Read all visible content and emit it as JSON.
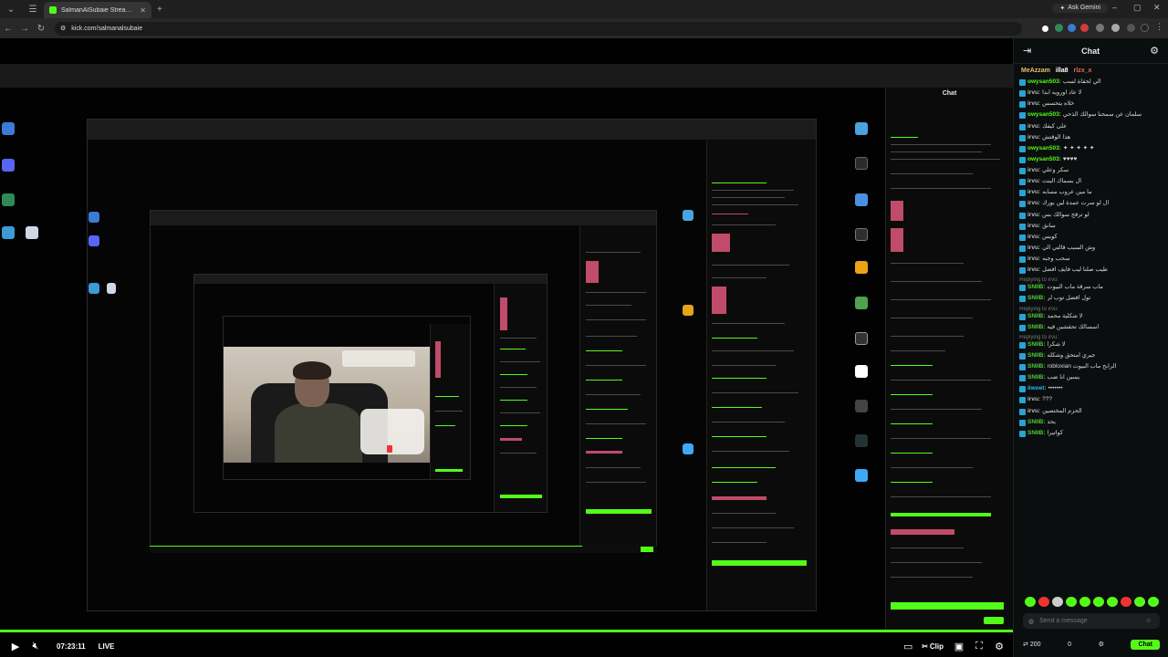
{
  "browser": {
    "tabs": [
      {
        "title": "SalmanAlSubaie Stream - Wa",
        "active": true
      }
    ],
    "ask_gemini": "Ask Gemini",
    "url": "kick.com/salmanalsubaie"
  },
  "nested_chat_title": "Chat",
  "player": {
    "time": "07:23:11",
    "live": "LIVE",
    "clip": "Clip"
  },
  "chat": {
    "title": "Chat",
    "pinned": [
      "MeAzzam",
      "illa8",
      "rlzx_x"
    ],
    "messages": [
      {
        "user": "owysan503:",
        "text": "الي لحقاة لسب",
        "cls": "u-owysan"
      },
      {
        "user": "irvu:",
        "text": "لا عاد اورويه ابداً",
        "cls": "u-irvu"
      },
      {
        "user": "irvu:",
        "text": "خلاه يتحسس",
        "cls": "u-irvu"
      },
      {
        "user": "owysan503:",
        "text": "سلمان عن سمحنا سوالك الذحي",
        "cls": "u-owysan"
      },
      {
        "user": "irvu:",
        "text": "على كيفك",
        "cls": "u-irvu"
      },
      {
        "user": "irvu:",
        "text": "هذا الوقتش",
        "cls": "u-irvu"
      },
      {
        "user": "owysan503:",
        "text": "✦ ✦ ✦ ✦ ✦",
        "cls": "u-owysan"
      },
      {
        "user": "owysan503:",
        "text": "♥♥♥♥",
        "cls": "u-owysan"
      },
      {
        "user": "irvu:",
        "text": "سكر وعلي",
        "cls": "u-irvu"
      },
      {
        "user": "irvu:",
        "text": "ال بسماك البنت",
        "cls": "u-irvu"
      },
      {
        "user": "irvu:",
        "text": "ما مين عروب مسابه",
        "cls": "u-irvu"
      },
      {
        "user": "irvu:",
        "text": "ال لو سرت عمدة لين بورك",
        "cls": "u-irvu"
      },
      {
        "user": "irvu:",
        "text": "لو ترقح سوالك بس",
        "cls": "u-irvu"
      },
      {
        "user": "irvu:",
        "text": "سانق",
        "cls": "u-irvu"
      },
      {
        "user": "irvu:",
        "text": "كويس",
        "cls": "u-irvu"
      },
      {
        "user": "irvu:",
        "text": "وش السبب قالتي الي",
        "cls": "u-irvu"
      },
      {
        "user": "irvu:",
        "text": "سحب وجبه",
        "cls": "u-irvu"
      },
      {
        "user": "irvu:",
        "text": "طيب صلنا ليب فايف افضل",
        "cls": "u-irvu"
      },
      {
        "user": "SNIIB:",
        "text": "ماب سرقة ماب البيوت",
        "cls": "u-snib",
        "reply": "Replying to irvu:"
      },
      {
        "user": "SNIIB:",
        "text": "تول افضل توب لر",
        "cls": "u-snib"
      },
      {
        "user": "SNIIB:",
        "text": "لا شكلية محمد",
        "cls": "u-snib",
        "reply": "Replying to irvu:"
      },
      {
        "user": "SNIIB:",
        "text": "اسسالك تحقشين قيه",
        "cls": "u-snib"
      },
      {
        "user": "SNIIB:",
        "text": "لا شكرا",
        "cls": "u-snib",
        "reply": "Replying to irvu:"
      },
      {
        "user": "SNIIB:",
        "text": "جيري امتحق وشكله",
        "cls": "u-snib"
      },
      {
        "user": "SNIIB:",
        "text": "robloxian الرابح ماب البيوت",
        "cls": "u-snib"
      },
      {
        "user": "SNIIB:",
        "text": "يسين انا ضب",
        "cls": "u-snib"
      },
      {
        "user": "iiwoet:",
        "text": "•••••••",
        "cls": "u-iiwoet"
      },
      {
        "user": "irvu:",
        "text": "???",
        "cls": "u-irvu"
      },
      {
        "user": "irvu:",
        "text": "الحزم المختصين",
        "cls": "u-irvu"
      },
      {
        "user": "SNIIB:",
        "text": "يحذ",
        "cls": "u-snib"
      },
      {
        "user": "SNIIB:",
        "text": "كواتيرا",
        "cls": "u-snib"
      }
    ],
    "input_placeholder": "Send a message",
    "viewer_count": "200",
    "points": "0",
    "send_label": "Chat"
  }
}
